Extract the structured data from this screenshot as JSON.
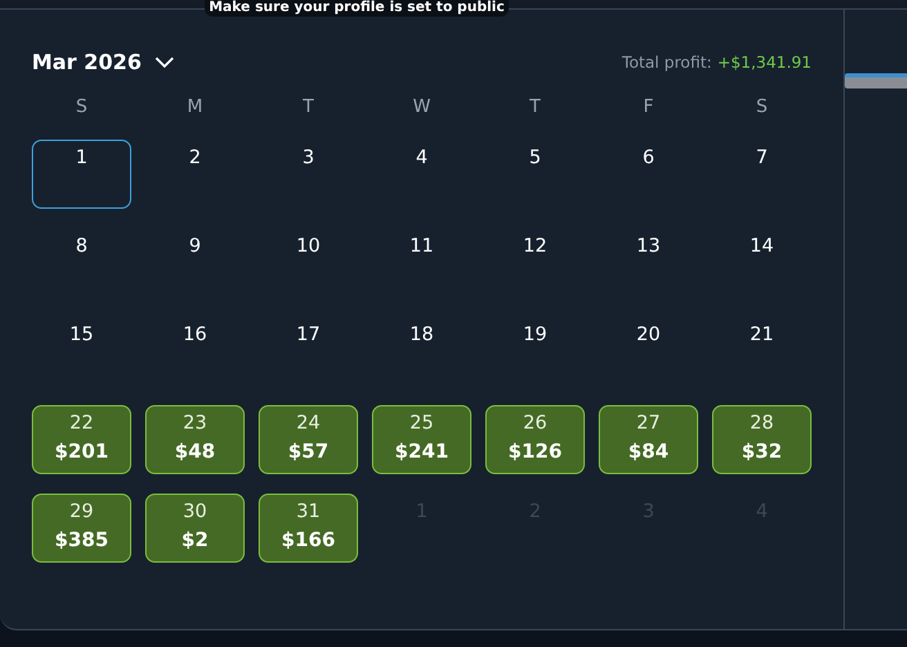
{
  "tooltip": "Make sure your profile is set to public",
  "calendar": {
    "month": "Mar 2026",
    "total_label": "Total profit:",
    "total_value": "+$1,341.91",
    "weekdays": [
      "S",
      "M",
      "T",
      "W",
      "T",
      "F",
      "S"
    ],
    "days": [
      {
        "day": "1",
        "kind": "current",
        "selected": true
      },
      {
        "day": "2",
        "kind": "current",
        "selected": false
      },
      {
        "day": "3",
        "kind": "current",
        "selected": false
      },
      {
        "day": "4",
        "kind": "current",
        "selected": false
      },
      {
        "day": "5",
        "kind": "current",
        "selected": false
      },
      {
        "day": "6",
        "kind": "current",
        "selected": false
      },
      {
        "day": "7",
        "kind": "current",
        "selected": false
      },
      {
        "day": "8",
        "kind": "current",
        "selected": false
      },
      {
        "day": "9",
        "kind": "current",
        "selected": false
      },
      {
        "day": "10",
        "kind": "current",
        "selected": false
      },
      {
        "day": "11",
        "kind": "current",
        "selected": false
      },
      {
        "day": "12",
        "kind": "current",
        "selected": false
      },
      {
        "day": "13",
        "kind": "current",
        "selected": false
      },
      {
        "day": "14",
        "kind": "current",
        "selected": false
      },
      {
        "day": "15",
        "kind": "current",
        "selected": false
      },
      {
        "day": "16",
        "kind": "current",
        "selected": false
      },
      {
        "day": "17",
        "kind": "current",
        "selected": false
      },
      {
        "day": "18",
        "kind": "current",
        "selected": false
      },
      {
        "day": "19",
        "kind": "current",
        "selected": false
      },
      {
        "day": "20",
        "kind": "current",
        "selected": false
      },
      {
        "day": "21",
        "kind": "current",
        "selected": false
      },
      {
        "day": "22",
        "kind": "profit",
        "profit": "$201",
        "selected": false
      },
      {
        "day": "23",
        "kind": "profit",
        "profit": "$48",
        "selected": false
      },
      {
        "day": "24",
        "kind": "profit",
        "profit": "$57",
        "selected": false
      },
      {
        "day": "25",
        "kind": "profit",
        "profit": "$241",
        "selected": false
      },
      {
        "day": "26",
        "kind": "profit",
        "profit": "$126",
        "selected": false
      },
      {
        "day": "27",
        "kind": "profit",
        "profit": "$84",
        "selected": false
      },
      {
        "day": "28",
        "kind": "profit",
        "profit": "$32",
        "selected": false
      },
      {
        "day": "29",
        "kind": "profit",
        "profit": "$385",
        "selected": false
      },
      {
        "day": "30",
        "kind": "profit",
        "profit": "$2",
        "selected": false
      },
      {
        "day": "31",
        "kind": "profit",
        "profit": "$166",
        "selected": false
      },
      {
        "day": "1",
        "kind": "other",
        "selected": false
      },
      {
        "day": "2",
        "kind": "other",
        "selected": false
      },
      {
        "day": "3",
        "kind": "other",
        "selected": false
      },
      {
        "day": "4",
        "kind": "other",
        "selected": false
      }
    ]
  }
}
